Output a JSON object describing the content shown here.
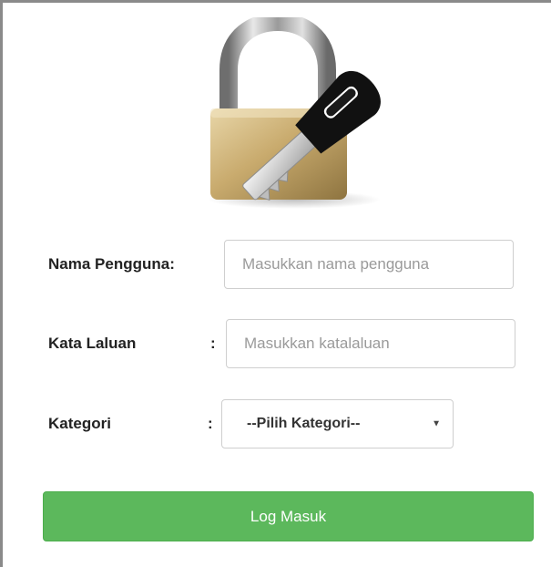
{
  "form": {
    "username_label": "Nama Pengguna:",
    "username_placeholder": "Masukkan nama pengguna",
    "password_label": "Kata Laluan",
    "password_colon": ":",
    "password_placeholder": "Masukkan katalaluan",
    "category_label": "Kategori",
    "category_colon": ":",
    "category_selected": "--Pilih Kategori--",
    "submit_label": "Log Masuk"
  },
  "icons": {
    "logo": "padlock-key-icon",
    "dropdown": "caret-down-icon"
  },
  "colors": {
    "submit_bg": "#5cb85c",
    "frame_border": "#8a8a8a"
  }
}
